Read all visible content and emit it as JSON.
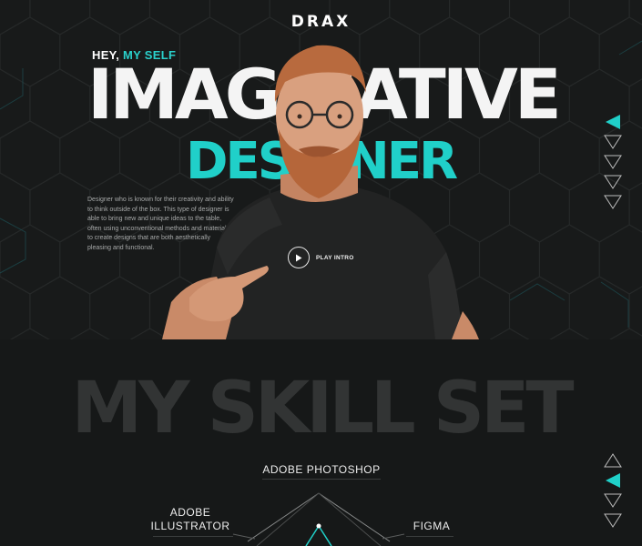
{
  "brand": {
    "logo": "DRAX",
    "accent": "#2ad1cc"
  },
  "hero": {
    "greeting_prefix": "HEY,",
    "greeting_accent": "MY SELF",
    "headline_line1": "IMAGINATIVE",
    "headline_line2": "DESIGNER",
    "intro": "Designer who is known for their creativity and ability to think outside of the box. This type of designer is able to bring new and unique ideas to the table, often using unconventional methods and materials to create designs that are both aesthetically pleasing and functional.",
    "play_label": "PLAY INTRO",
    "photo_icon": "person-photo"
  },
  "nav_top": {
    "count": 5,
    "active_index": 0
  },
  "skills": {
    "title": "MY SKILL SET",
    "items": [
      {
        "label": "ADOBE PHOTOSHOP"
      },
      {
        "label_line1": "ADOBE",
        "label_line2": "ILLUSTRATOR"
      },
      {
        "label": "FIGMA"
      }
    ]
  },
  "nav_bottom": {
    "count": 4,
    "active_index": 1
  },
  "colors": {
    "background": "#161818",
    "hero_bg": "#181a1a",
    "teal": "#20d0c9",
    "title_gray": "#323434"
  }
}
